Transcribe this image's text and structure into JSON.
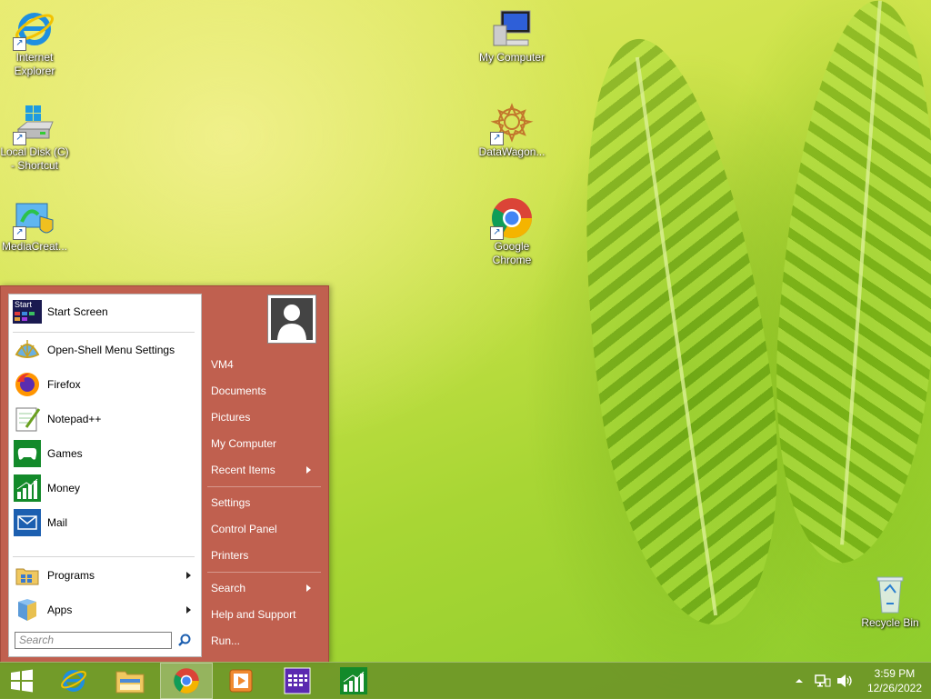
{
  "desktop": {
    "icons": [
      {
        "label_line1": "Internet",
        "label_line2": "Explorer"
      },
      {
        "label_line1": "Local Disk (C)",
        "label_line2": "- Shortcut"
      },
      {
        "label_line1": "MediaCreat...",
        "label_line2": ""
      },
      {
        "label_line1": "My Computer",
        "label_line2": ""
      },
      {
        "label_line1": "DataWagon...",
        "label_line2": ""
      },
      {
        "label_line1": "Google",
        "label_line2": "Chrome"
      },
      {
        "label_line1": "Recycle Bin",
        "label_line2": ""
      }
    ]
  },
  "startmenu": {
    "left_items": [
      {
        "label": "Start Screen",
        "icon": "start-screen-icon"
      },
      {
        "label": "Open-Shell Menu Settings",
        "icon": "open-shell-icon"
      },
      {
        "label": "Firefox",
        "icon": "firefox-icon"
      },
      {
        "label": "Notepad++",
        "icon": "notepad-plus-icon"
      },
      {
        "label": "Games",
        "icon": "games-icon"
      },
      {
        "label": "Money",
        "icon": "money-icon"
      },
      {
        "label": "Mail",
        "icon": "mail-icon"
      }
    ],
    "programs_label": "Programs",
    "apps_label": "Apps",
    "search_placeholder": "Search",
    "start_icon_text": "Start",
    "right_items": [
      {
        "label": "VM4"
      },
      {
        "label": "Documents"
      },
      {
        "label": "Pictures"
      },
      {
        "label": "My Computer"
      },
      {
        "label": "Recent Items"
      },
      {
        "label": "Settings"
      },
      {
        "label": "Control Panel"
      },
      {
        "label": "Printers"
      },
      {
        "label": "Search"
      },
      {
        "label": "Help and Support"
      },
      {
        "label": "Run..."
      }
    ]
  },
  "taskbar": {
    "time": "3:59 PM",
    "date": "12/26/2022"
  },
  "colors": {
    "menu_right_bg": "#c0604f",
    "taskbar_bg": "#6e9628"
  }
}
